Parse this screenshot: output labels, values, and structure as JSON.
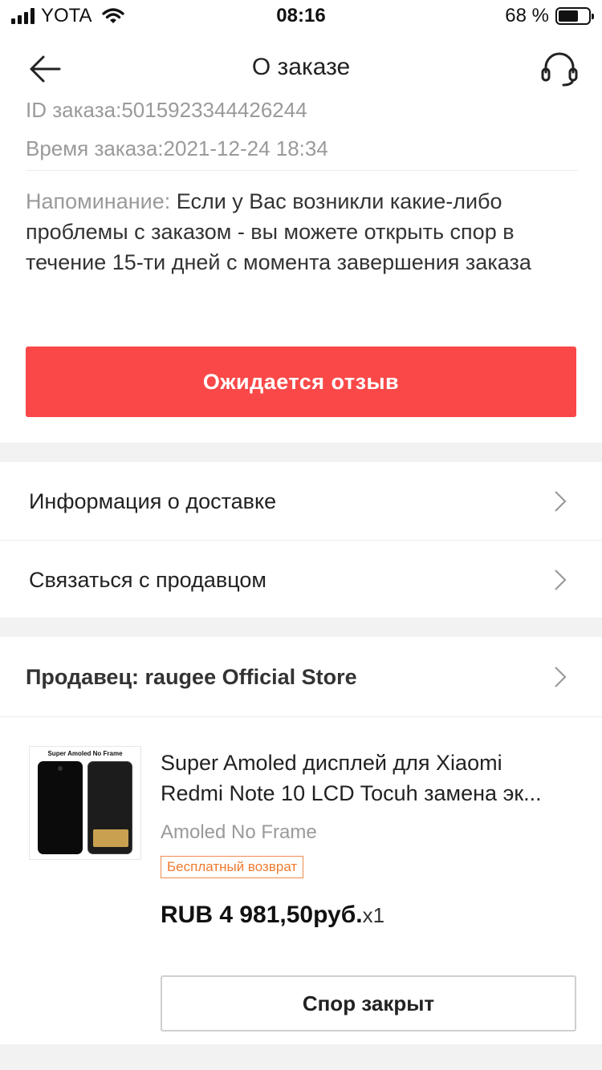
{
  "status_bar": {
    "carrier": "YOTA",
    "time": "08:16",
    "battery_percent": "68 %",
    "battery_level": 0.68
  },
  "nav": {
    "title": "О заказе",
    "back_icon": "arrow-left-icon",
    "support_icon": "headset-icon"
  },
  "order": {
    "id_text": "ID заказа:5015923344426244",
    "time_text": "Время заказа:2021-12-24 18:34",
    "reminder_label": "Напоминание: ",
    "reminder_text": "Если у Вас возникли какие-либо проблемы с заказом - вы можете открыть спор в течение 15-ти дней с момента завершения заказа"
  },
  "review_button": {
    "label": "Ожидается отзыв",
    "color": "#fa4848"
  },
  "menu": [
    {
      "label": "Информация о доставке"
    },
    {
      "label": "Связаться с продавцом"
    }
  ],
  "seller": {
    "label": "Продавец: raugee Official Store"
  },
  "product": {
    "image_label": "Super Amoled No Frame",
    "title_line1": "Super Amoled дисплей для Xiaomi",
    "title_line2": "Redmi Note 10 LCD Tocuh замена эк...",
    "variant": "Amoled No Frame",
    "badge": "Бесплатный возврат",
    "price": "RUB 4 981,50руб.",
    "quantity": "x1"
  },
  "dispute_button": {
    "label": "Спор закрыт"
  }
}
